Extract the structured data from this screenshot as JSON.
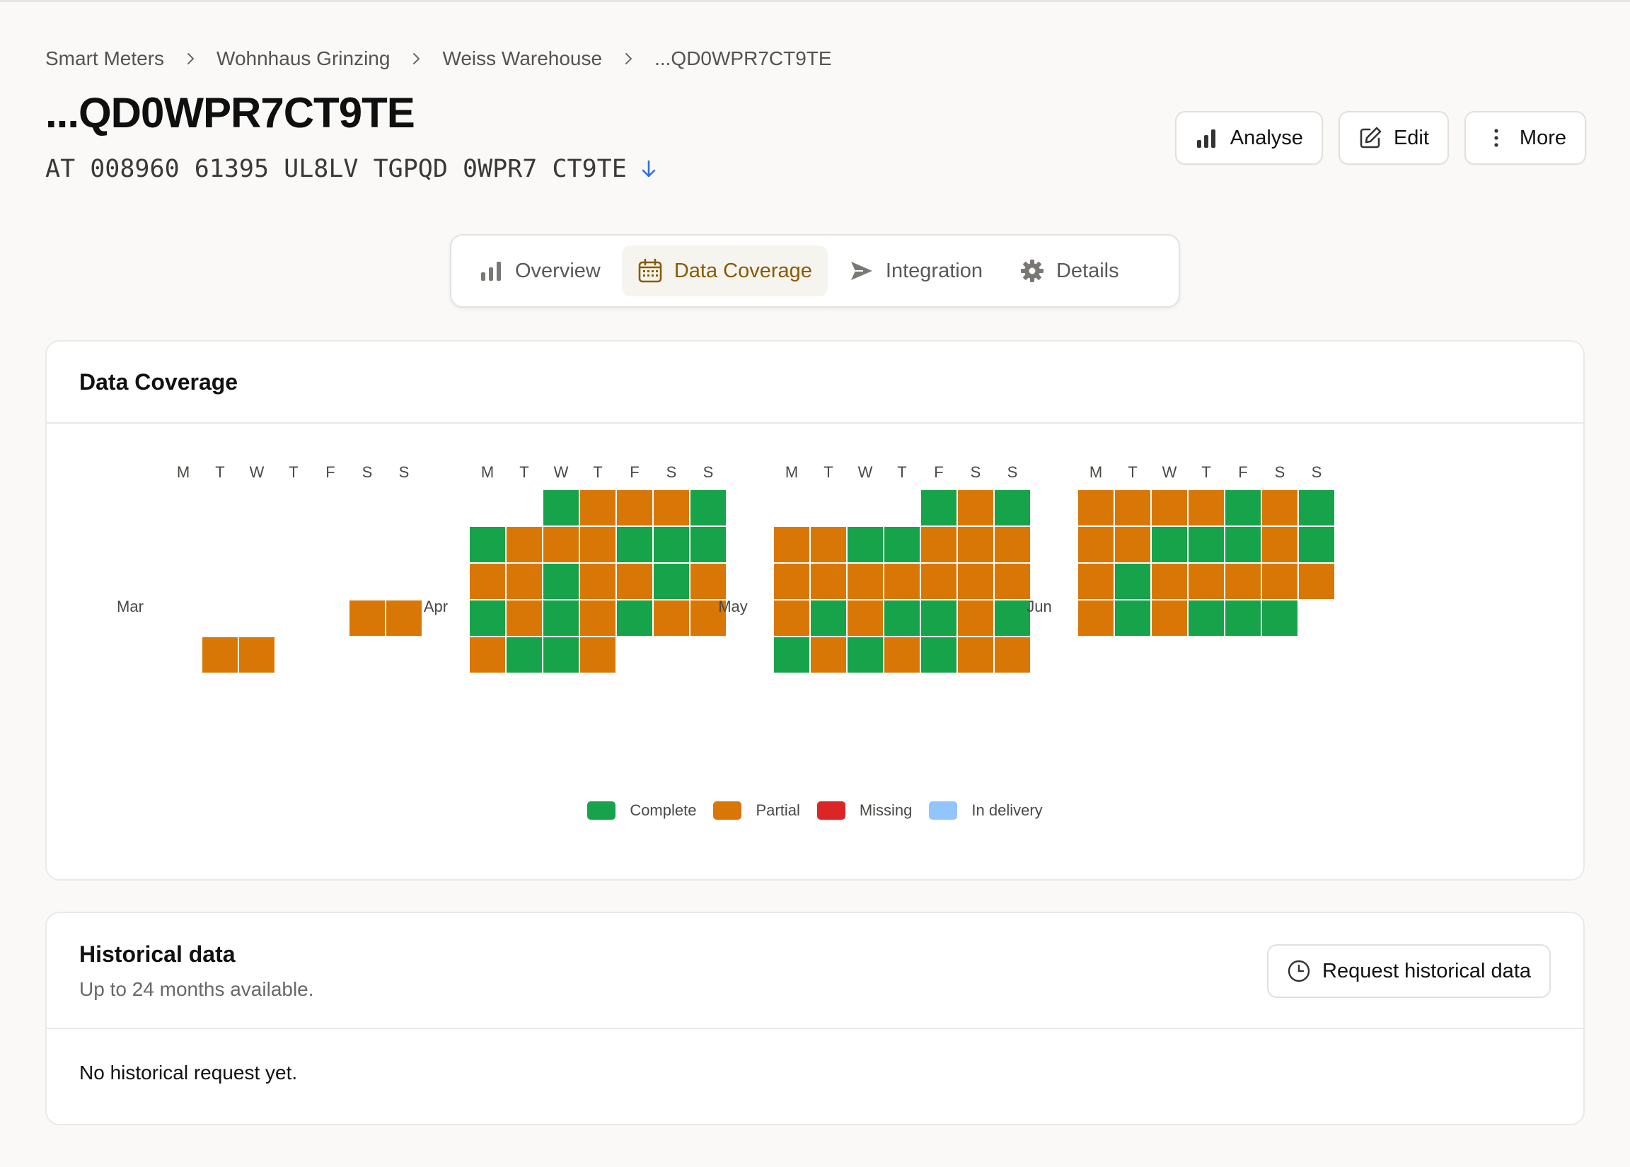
{
  "breadcrumb": [
    "Smart Meters",
    "Wohnhaus Grinzing",
    "Weiss Warehouse",
    "...QD0WPR7CT9TE"
  ],
  "page_title": "...QD0WPR7CT9TE",
  "meter_id": "AT 008960 61395 UL8LV TGPQD 0WPR7 CT9TE",
  "actions": {
    "analyse": "Analyse",
    "edit": "Edit",
    "more": "More"
  },
  "tabs": [
    {
      "label": "Overview",
      "active": false
    },
    {
      "label": "Data Coverage",
      "active": true
    },
    {
      "label": "Integration",
      "active": false
    },
    {
      "label": "Details",
      "active": false
    }
  ],
  "coverage": {
    "title": "Data Coverage",
    "weekdays": [
      "M",
      "T",
      "W",
      "T",
      "F",
      "S",
      "S"
    ],
    "months": [
      {
        "label": "Mar",
        "weeks": [
          [
            "",
            "",
            "",
            "",
            "",
            "",
            ""
          ],
          [
            "",
            "",
            "",
            "",
            "",
            "",
            ""
          ],
          [
            "",
            "",
            "",
            "",
            "",
            "",
            ""
          ],
          [
            "",
            "",
            "",
            "",
            "",
            "P",
            "P"
          ],
          [
            "",
            "P",
            "P",
            "",
            "",
            "",
            ""
          ]
        ]
      },
      {
        "label": "Apr",
        "weeks": [
          [
            "",
            "",
            "C",
            "P",
            "P",
            "P",
            "C"
          ],
          [
            "C",
            "P",
            "P",
            "P",
            "C",
            "C",
            "C"
          ],
          [
            "P",
            "P",
            "C",
            "P",
            "P",
            "C",
            "P"
          ],
          [
            "C",
            "P",
            "C",
            "P",
            "C",
            "P",
            "P"
          ],
          [
            "P",
            "C",
            "C",
            "P",
            "",
            "",
            ""
          ]
        ]
      },
      {
        "label": "May",
        "weeks": [
          [
            "",
            "",
            "",
            "",
            "C",
            "P",
            "C"
          ],
          [
            "P",
            "P",
            "C",
            "C",
            "P",
            "P",
            "P"
          ],
          [
            "P",
            "P",
            "P",
            "P",
            "P",
            "P",
            "P"
          ],
          [
            "P",
            "C",
            "P",
            "C",
            "C",
            "P",
            "C"
          ],
          [
            "C",
            "P",
            "C",
            "P",
            "C",
            "P",
            "P"
          ]
        ]
      },
      {
        "label": "Jun",
        "weeks": [
          [
            "P",
            "P",
            "P",
            "P",
            "C",
            "P",
            "C"
          ],
          [
            "P",
            "P",
            "C",
            "C",
            "C",
            "P",
            "C"
          ],
          [
            "P",
            "C",
            "P",
            "P",
            "P",
            "P",
            "P"
          ],
          [
            "P",
            "C",
            "P",
            "C",
            "C",
            "C",
            ""
          ]
        ]
      }
    ],
    "colors": {
      "C": "#16a34a",
      "P": "#d97706",
      "M": "#dc2626",
      "D": "#93c5fd"
    },
    "legend": [
      {
        "label": "Complete",
        "color": "#16a34a"
      },
      {
        "label": "Partial",
        "color": "#d97706"
      },
      {
        "label": "Missing",
        "color": "#dc2626"
      },
      {
        "label": "In delivery",
        "color": "#93c5fd"
      }
    ]
  },
  "historical": {
    "title": "Historical data",
    "subtitle": "Up to 24 months available.",
    "button": "Request historical data",
    "empty": "No historical request yet."
  }
}
